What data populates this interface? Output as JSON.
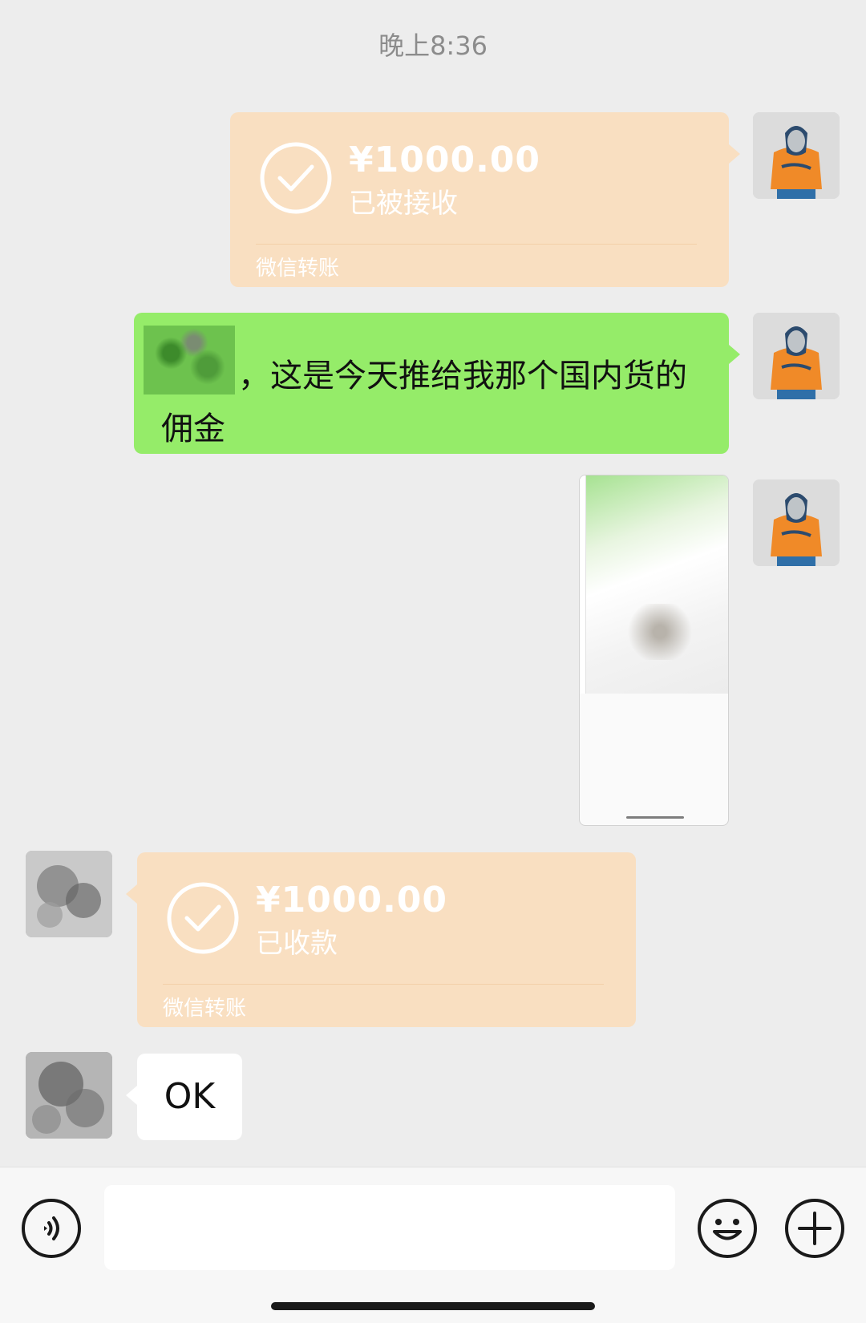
{
  "time": "晚上8:36",
  "messages": [
    {
      "type": "transfer",
      "direction": "sent",
      "amount": "¥1000.00",
      "status": "已被接收",
      "footer": "微信转账"
    },
    {
      "type": "text",
      "direction": "sent",
      "text": "，这是今天推给我那个国内货的佣金"
    },
    {
      "type": "image",
      "direction": "sent"
    },
    {
      "type": "transfer",
      "direction": "received",
      "amount": "¥1000.00",
      "status": "已收款",
      "footer": "微信转账"
    },
    {
      "type": "text",
      "direction": "received",
      "text": "OK"
    }
  ],
  "input": {
    "value": ""
  },
  "icons": [
    "voice-icon",
    "emoji-icon",
    "plus-icon",
    "check-icon",
    "avatar"
  ],
  "colors": {
    "background": "#ededed",
    "sent_bubble": "#95ec69",
    "transfer_card": "#f9dfc1",
    "received_bubble": "#ffffff"
  }
}
